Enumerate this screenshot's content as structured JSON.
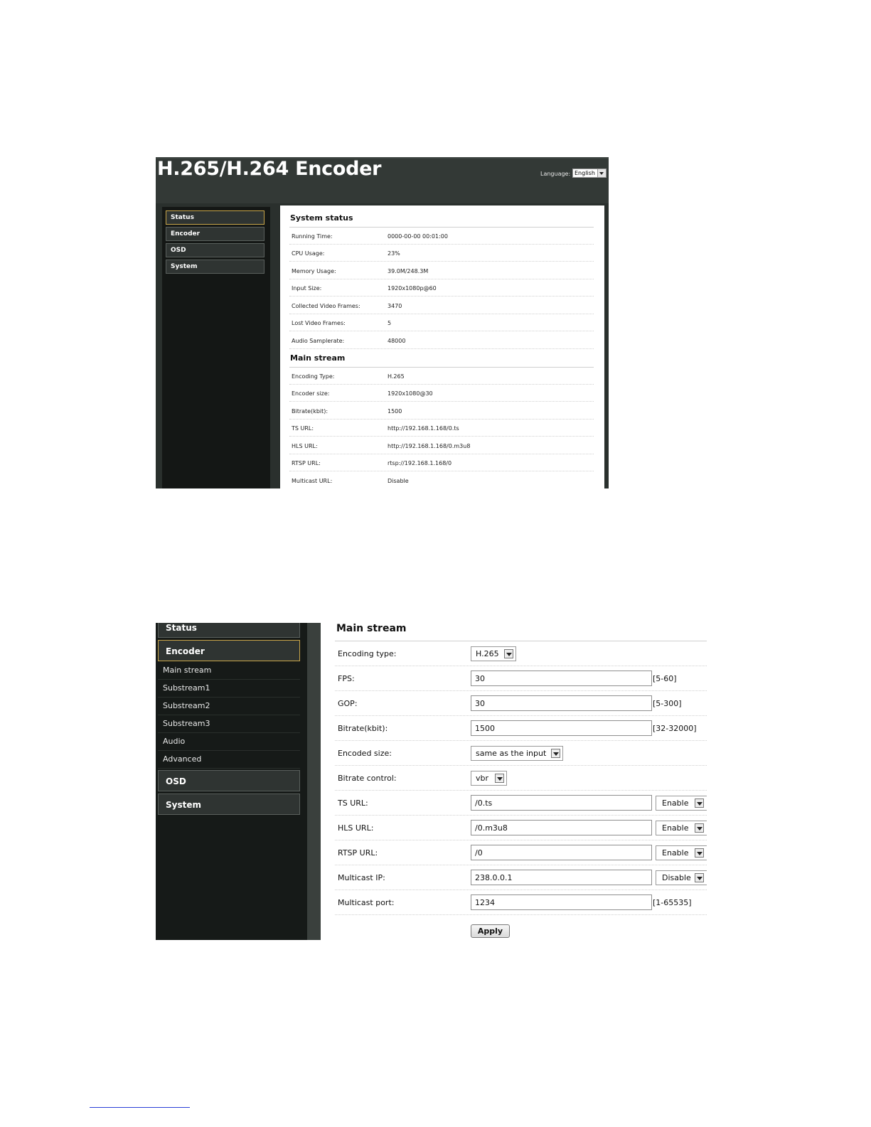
{
  "shot1": {
    "app_title": "H.265/H.264 Encoder",
    "language_label": "Language:",
    "language_value": "English",
    "nav": [
      "Status",
      "Encoder",
      "OSD",
      "System"
    ],
    "system_status": {
      "title": "System status",
      "rows": [
        {
          "k": "Running Time:",
          "v": "0000-00-00 00:01:00"
        },
        {
          "k": "CPU Usage:",
          "v": "23%"
        },
        {
          "k": "Memory Usage:",
          "v": "39.0M/248.3M"
        },
        {
          "k": "Input Size:",
          "v": "1920x1080p@60"
        },
        {
          "k": "Collected Video Frames:",
          "v": "3470"
        },
        {
          "k": "Lost Video Frames:",
          "v": "5"
        },
        {
          "k": "Audio Samplerate:",
          "v": "48000"
        }
      ]
    },
    "main_stream": {
      "title": "Main stream",
      "rows": [
        {
          "k": "Encoding Type:",
          "v": "H.265"
        },
        {
          "k": "Encoder size:",
          "v": "1920x1080@30"
        },
        {
          "k": "Bitrate(kbit):",
          "v": "1500"
        },
        {
          "k": "TS URL:",
          "v": "http://192.168.1.168/0.ts"
        },
        {
          "k": "HLS URL:",
          "v": "http://192.168.1.168/0.m3u8"
        },
        {
          "k": "RTSP URL:",
          "v": "rtsp://192.168.1.168/0"
        },
        {
          "k": "Multicast URL:",
          "v": "Disable"
        }
      ]
    }
  },
  "shot2": {
    "nav": {
      "status": "Status",
      "encoder": "Encoder",
      "osd": "OSD",
      "system": "System"
    },
    "sub_items": [
      "Main stream",
      "Substream1",
      "Substream2",
      "Substream3",
      "Audio",
      "Advanced"
    ],
    "title": "Main stream",
    "fields": {
      "encoding_type": {
        "label": "Encoding type:",
        "value": "H.265"
      },
      "fps": {
        "label": "FPS:",
        "value": "30",
        "range": "[5-60]"
      },
      "gop": {
        "label": "GOP:",
        "value": "30",
        "range": "[5-300]"
      },
      "bitrate": {
        "label": "Bitrate(kbit):",
        "value": "1500",
        "range": "[32-32000]"
      },
      "encoded_size": {
        "label": "Encoded size:",
        "value": "same as the input"
      },
      "bitrate_control": {
        "label": "Bitrate control:",
        "value": "vbr"
      },
      "ts_url": {
        "label": "TS URL:",
        "value": "/0.ts",
        "state": "Enable"
      },
      "hls_url": {
        "label": "HLS URL:",
        "value": "/0.m3u8",
        "state": "Enable"
      },
      "rtsp_url": {
        "label": "RTSP URL:",
        "value": "/0",
        "state": "Enable"
      },
      "multicast_ip": {
        "label": "Multicast IP:",
        "value": "238.0.0.1",
        "state": "Disable"
      },
      "multicast_port": {
        "label": "Multicast port:",
        "value": "1234",
        "range": "[1-65535]"
      }
    },
    "apply_label": "Apply"
  }
}
